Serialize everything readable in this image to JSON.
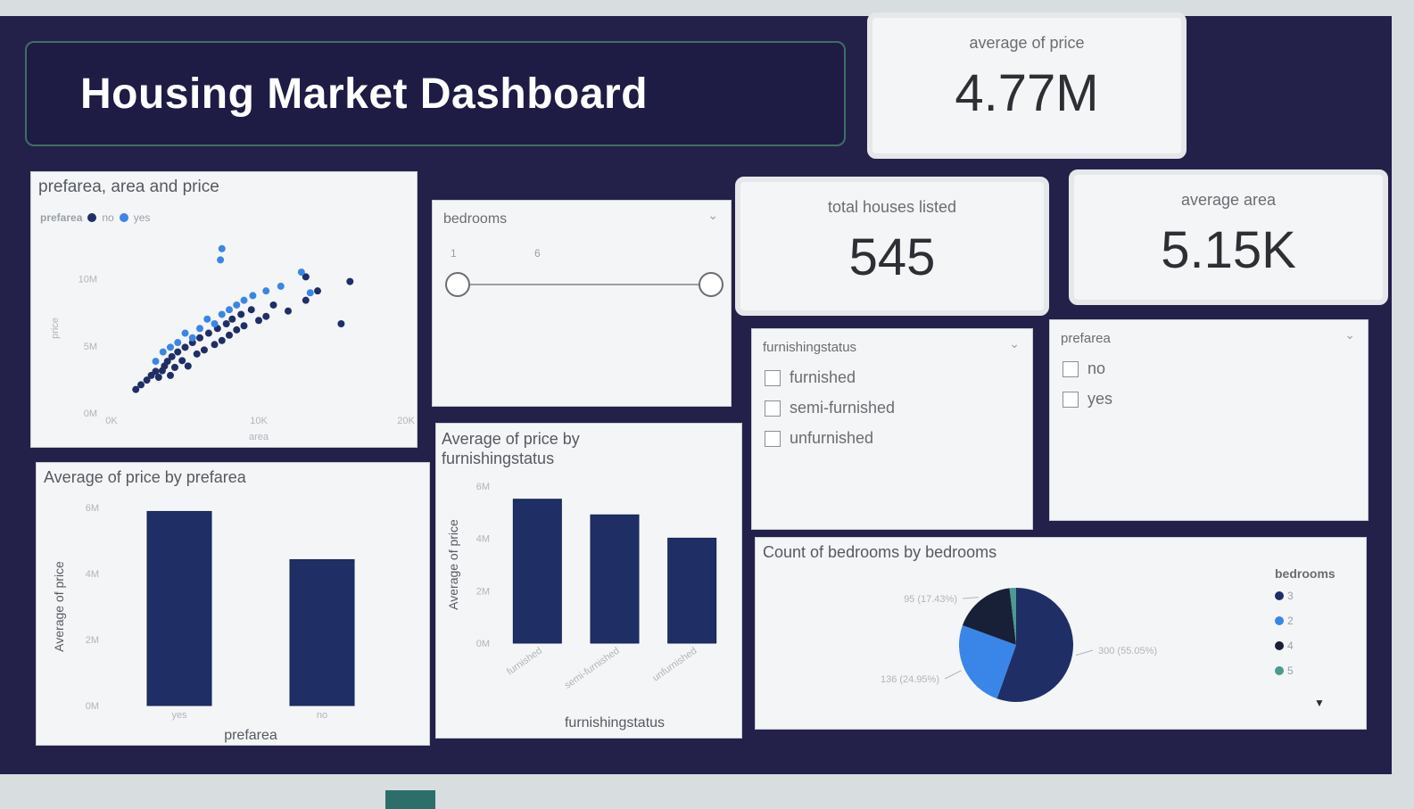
{
  "dashboard": {
    "title": "Housing Market Dashboard"
  },
  "kpis": {
    "avg_price": {
      "label": "average of price",
      "value": "4.77M"
    },
    "total_houses": {
      "label": "total houses listed",
      "value": "545"
    },
    "avg_area": {
      "label": "average area",
      "value": "5.15K"
    }
  },
  "slicers": {
    "bedrooms": {
      "title": "bedrooms",
      "min": "1",
      "max": "6"
    },
    "furnishingstatus": {
      "title": "furnishingstatus",
      "options": [
        "furnished",
        "semi-furnished",
        "unfurnished"
      ]
    },
    "prefarea": {
      "title": "prefarea",
      "options": [
        "no",
        "yes"
      ]
    }
  },
  "colors": {
    "navy": "#1f2f66",
    "blue": "#3a86e8",
    "teal": "#4c9a90",
    "dark": "#182038"
  },
  "scatter": {
    "title": "prefarea, area and price",
    "legend_title": "prefarea",
    "legend": [
      "no",
      "yes"
    ],
    "xlabel": "area",
    "ylabel": "price",
    "x_ticks": [
      "0K",
      "10K",
      "20K"
    ],
    "y_ticks": [
      "0M",
      "5M",
      "10M"
    ]
  },
  "chart_data": [
    {
      "type": "scatter",
      "title": "prefarea, area and price",
      "xlabel": "area",
      "ylabel": "price",
      "xlim": [
        0,
        20000
      ],
      "ylim": [
        0,
        13300000
      ],
      "series": [
        {
          "name": "no",
          "color": "#1f2f66",
          "points": [
            [
              1650,
              1750000
            ],
            [
              2000,
              2100000
            ],
            [
              2400,
              2450000
            ],
            [
              2700,
              2800000
            ],
            [
              3000,
              3100000
            ],
            [
              3200,
              2660000
            ],
            [
              3450,
              3150000
            ],
            [
              3600,
              3500000
            ],
            [
              3800,
              3850000
            ],
            [
              4000,
              2800000
            ],
            [
              4100,
              4200000
            ],
            [
              4300,
              3400000
            ],
            [
              4500,
              4550000
            ],
            [
              4800,
              3900000
            ],
            [
              5000,
              4900000
            ],
            [
              5200,
              3500000
            ],
            [
              5500,
              5250000
            ],
            [
              5800,
              4400000
            ],
            [
              6000,
              5600000
            ],
            [
              6300,
              4700000
            ],
            [
              6600,
              5950000
            ],
            [
              7000,
              5100000
            ],
            [
              7200,
              6300000
            ],
            [
              7500,
              5400000
            ],
            [
              7800,
              6650000
            ],
            [
              8000,
              5800000
            ],
            [
              8200,
              7000000
            ],
            [
              8500,
              6200000
            ],
            [
              8800,
              7350000
            ],
            [
              9000,
              6500000
            ],
            [
              9500,
              7700000
            ],
            [
              10000,
              6900000
            ],
            [
              10500,
              7200000
            ],
            [
              11000,
              8050000
            ],
            [
              12000,
              7600000
            ],
            [
              13200,
              8400000
            ],
            [
              14000,
              9100000
            ],
            [
              15600,
              6650000
            ],
            [
              16200,
              9800000
            ],
            [
              13200,
              10150000
            ]
          ]
        },
        {
          "name": "yes",
          "color": "#3a86e8",
          "points": [
            [
              3000,
              3850000
            ],
            [
              3500,
              4550000
            ],
            [
              4000,
              4900000
            ],
            [
              4500,
              5250000
            ],
            [
              5000,
              5950000
            ],
            [
              5500,
              5600000
            ],
            [
              6000,
              6300000
            ],
            [
              6500,
              7000000
            ],
            [
              7000,
              6650000
            ],
            [
              7500,
              7350000
            ],
            [
              8000,
              7700000
            ],
            [
              8500,
              8050000
            ],
            [
              9000,
              8400000
            ],
            [
              9600,
              8750000
            ],
            [
              10500,
              9100000
            ],
            [
              11500,
              9450000
            ],
            [
              12900,
              10500000
            ],
            [
              13500,
              8960000
            ],
            [
              7400,
              11410000
            ],
            [
              7500,
              12250000
            ]
          ]
        }
      ]
    },
    {
      "type": "bar",
      "title": "Average of price by prefarea",
      "xlabel": "prefarea",
      "ylabel": "Average of price",
      "categories": [
        "yes",
        "no"
      ],
      "values": [
        5880000,
        4420000
      ],
      "ylim": [
        0,
        6000000
      ],
      "y_ticks": [
        "0M",
        "2M",
        "4M",
        "6M"
      ]
    },
    {
      "type": "bar",
      "title": "Average of price by furnishingstatus",
      "xlabel": "furnishingstatus",
      "ylabel": "Average of price",
      "categories": [
        "furnished",
        "semi-furnished",
        "unfurnished"
      ],
      "values": [
        5500000,
        4900000,
        4010000
      ],
      "ylim": [
        0,
        6000000
      ],
      "y_ticks": [
        "0M",
        "2M",
        "4M",
        "6M"
      ]
    },
    {
      "type": "pie",
      "title": "Count of bedrooms by bedrooms",
      "legend_title": "bedrooms",
      "categories": [
        "3",
        "2",
        "4",
        "5"
      ],
      "values": [
        300,
        136,
        95,
        10
      ],
      "colors": [
        "#1f2f66",
        "#3a86e8",
        "#182038",
        "#4c9a90"
      ],
      "data_labels": [
        "300 (55.05%)",
        "136 (24.95%)",
        "95 (17.43%)"
      ]
    }
  ]
}
